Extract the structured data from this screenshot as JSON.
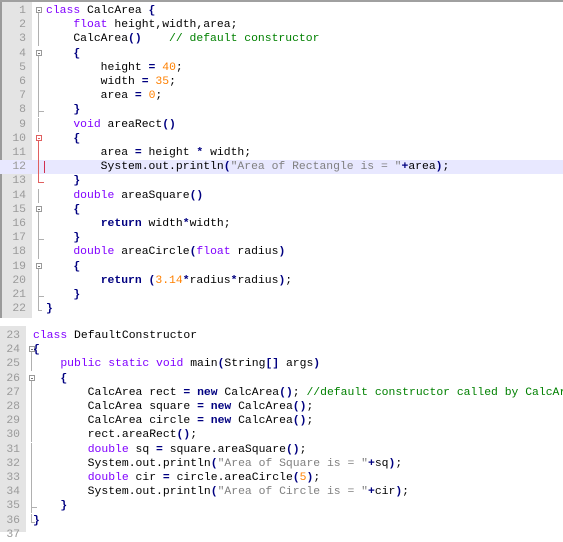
{
  "editor": {
    "panels": [
      {
        "id": "top",
        "lines": [
          {
            "n": "1",
            "tokens": [
              {
                "t": "class",
                "c": "kw"
              },
              {
                "t": " CalcArea ",
                "c": "txt"
              },
              {
                "t": "{",
                "c": "op"
              }
            ]
          },
          {
            "n": "2",
            "tokens": [
              {
                "t": "    ",
                "c": "txt"
              },
              {
                "t": "float",
                "c": "kw"
              },
              {
                "t": " height,width,area;",
                "c": "txt"
              }
            ]
          },
          {
            "n": "3",
            "tokens": [
              {
                "t": "    CalcArea",
                "c": "txt"
              },
              {
                "t": "()",
                "c": "op"
              },
              {
                "t": "    ",
                "c": "txt"
              },
              {
                "t": "// default constructor",
                "c": "cmt"
              }
            ]
          },
          {
            "n": "4",
            "tokens": [
              {
                "t": "    ",
                "c": "txt"
              },
              {
                "t": "{",
                "c": "op"
              }
            ]
          },
          {
            "n": "5",
            "tokens": [
              {
                "t": "        height ",
                "c": "txt"
              },
              {
                "t": "=",
                "c": "op"
              },
              {
                "t": " ",
                "c": "txt"
              },
              {
                "t": "40",
                "c": "num"
              },
              {
                "t": ";",
                "c": "txt"
              }
            ]
          },
          {
            "n": "6",
            "tokens": [
              {
                "t": "        width ",
                "c": "txt"
              },
              {
                "t": "=",
                "c": "op"
              },
              {
                "t": " ",
                "c": "txt"
              },
              {
                "t": "35",
                "c": "num"
              },
              {
                "t": ";",
                "c": "txt"
              }
            ]
          },
          {
            "n": "7",
            "tokens": [
              {
                "t": "        area ",
                "c": "txt"
              },
              {
                "t": "=",
                "c": "op"
              },
              {
                "t": " ",
                "c": "txt"
              },
              {
                "t": "0",
                "c": "num"
              },
              {
                "t": ";",
                "c": "txt"
              }
            ]
          },
          {
            "n": "8",
            "tokens": [
              {
                "t": "    ",
                "c": "txt"
              },
              {
                "t": "}",
                "c": "op"
              }
            ]
          },
          {
            "n": "9",
            "tokens": [
              {
                "t": "    ",
                "c": "txt"
              },
              {
                "t": "void",
                "c": "kw"
              },
              {
                "t": " areaRect",
                "c": "txt"
              },
              {
                "t": "()",
                "c": "op"
              }
            ]
          },
          {
            "n": "10",
            "tokens": [
              {
                "t": "    ",
                "c": "txt"
              },
              {
                "t": "{",
                "c": "op"
              }
            ]
          },
          {
            "n": "11",
            "tokens": [
              {
                "t": "        area ",
                "c": "txt"
              },
              {
                "t": "=",
                "c": "op"
              },
              {
                "t": " height ",
                "c": "txt"
              },
              {
                "t": "*",
                "c": "op"
              },
              {
                "t": " width;",
                "c": "txt"
              }
            ]
          },
          {
            "n": "12",
            "tokens": [
              {
                "t": "        System.out.println",
                "c": "txt"
              },
              {
                "t": "(",
                "c": "op"
              },
              {
                "t": "\"Area of Rectangle is = \"",
                "c": "str"
              },
              {
                "t": "+",
                "c": "op"
              },
              {
                "t": "area",
                "c": "txt"
              },
              {
                "t": ")",
                "c": "op"
              },
              {
                "t": ";",
                "c": "txt"
              }
            ]
          },
          {
            "n": "13",
            "tokens": [
              {
                "t": "    ",
                "c": "txt"
              },
              {
                "t": "}",
                "c": "op"
              }
            ]
          },
          {
            "n": "14",
            "tokens": [
              {
                "t": "    ",
                "c": "txt"
              },
              {
                "t": "double",
                "c": "kw"
              },
              {
                "t": " areaSquare",
                "c": "txt"
              },
              {
                "t": "()",
                "c": "op"
              }
            ]
          },
          {
            "n": "15",
            "tokens": [
              {
                "t": "    ",
                "c": "txt"
              },
              {
                "t": "{",
                "c": "op"
              }
            ]
          },
          {
            "n": "16",
            "tokens": [
              {
                "t": "        ",
                "c": "txt"
              },
              {
                "t": "return",
                "c": "kw2"
              },
              {
                "t": " width",
                "c": "txt"
              },
              {
                "t": "*",
                "c": "op"
              },
              {
                "t": "width;",
                "c": "txt"
              }
            ]
          },
          {
            "n": "17",
            "tokens": [
              {
                "t": "    ",
                "c": "txt"
              },
              {
                "t": "}",
                "c": "op"
              }
            ]
          },
          {
            "n": "18",
            "tokens": [
              {
                "t": "    ",
                "c": "txt"
              },
              {
                "t": "double",
                "c": "kw"
              },
              {
                "t": " areaCircle",
                "c": "txt"
              },
              {
                "t": "(",
                "c": "op"
              },
              {
                "t": "float",
                "c": "kw"
              },
              {
                "t": " radius",
                "c": "txt"
              },
              {
                "t": ")",
                "c": "op"
              }
            ]
          },
          {
            "n": "19",
            "tokens": [
              {
                "t": "    ",
                "c": "txt"
              },
              {
                "t": "{",
                "c": "op"
              }
            ]
          },
          {
            "n": "20",
            "tokens": [
              {
                "t": "        ",
                "c": "txt"
              },
              {
                "t": "return",
                "c": "kw2"
              },
              {
                "t": " ",
                "c": "txt"
              },
              {
                "t": "(",
                "c": "op"
              },
              {
                "t": "3.14",
                "c": "num"
              },
              {
                "t": "*",
                "c": "op"
              },
              {
                "t": "radius",
                "c": "txt"
              },
              {
                "t": "*",
                "c": "op"
              },
              {
                "t": "radius",
                "c": "txt"
              },
              {
                "t": ")",
                "c": "op"
              },
              {
                "t": ";",
                "c": "txt"
              }
            ]
          },
          {
            "n": "21",
            "tokens": [
              {
                "t": "    ",
                "c": "txt"
              },
              {
                "t": "}",
                "c": "op"
              }
            ]
          },
          {
            "n": "22",
            "tokens": [
              {
                "t": "}",
                "c": "op"
              }
            ]
          }
        ]
      },
      {
        "id": "bottom",
        "lines": [
          {
            "n": "23",
            "tokens": [
              {
                "t": "class",
                "c": "kw"
              },
              {
                "t": " DefaultConstructor",
                "c": "txt"
              }
            ]
          },
          {
            "n": "24",
            "tokens": [
              {
                "t": "{",
                "c": "op"
              }
            ]
          },
          {
            "n": "25",
            "tokens": [
              {
                "t": "    ",
                "c": "txt"
              },
              {
                "t": "public static void",
                "c": "kw"
              },
              {
                "t": " main",
                "c": "txt"
              },
              {
                "t": "(",
                "c": "op"
              },
              {
                "t": "String",
                "c": "txt"
              },
              {
                "t": "[]",
                "c": "op"
              },
              {
                "t": " args",
                "c": "txt"
              },
              {
                "t": ")",
                "c": "op"
              }
            ]
          },
          {
            "n": "26",
            "tokens": [
              {
                "t": "    ",
                "c": "txt"
              },
              {
                "t": "{",
                "c": "op"
              }
            ]
          },
          {
            "n": "27",
            "tokens": [
              {
                "t": "        CalcArea rect ",
                "c": "txt"
              },
              {
                "t": "=",
                "c": "op"
              },
              {
                "t": " ",
                "c": "txt"
              },
              {
                "t": "new",
                "c": "kw2"
              },
              {
                "t": " CalcArea",
                "c": "txt"
              },
              {
                "t": "()",
                "c": "op"
              },
              {
                "t": "; ",
                "c": "txt"
              },
              {
                "t": "//default constructor called by CalcArea();",
                "c": "cmt"
              }
            ]
          },
          {
            "n": "28",
            "tokens": [
              {
                "t": "        CalcArea square ",
                "c": "txt"
              },
              {
                "t": "=",
                "c": "op"
              },
              {
                "t": " ",
                "c": "txt"
              },
              {
                "t": "new",
                "c": "kw2"
              },
              {
                "t": " CalcArea",
                "c": "txt"
              },
              {
                "t": "()",
                "c": "op"
              },
              {
                "t": ";",
                "c": "txt"
              }
            ]
          },
          {
            "n": "29",
            "tokens": [
              {
                "t": "        CalcArea circle ",
                "c": "txt"
              },
              {
                "t": "=",
                "c": "op"
              },
              {
                "t": " ",
                "c": "txt"
              },
              {
                "t": "new",
                "c": "kw2"
              },
              {
                "t": " CalcArea",
                "c": "txt"
              },
              {
                "t": "()",
                "c": "op"
              },
              {
                "t": ";",
                "c": "txt"
              }
            ]
          },
          {
            "n": "30",
            "tokens": [
              {
                "t": "        rect.areaRect",
                "c": "txt"
              },
              {
                "t": "()",
                "c": "op"
              },
              {
                "t": ";",
                "c": "txt"
              }
            ]
          },
          {
            "n": "31",
            "tokens": [
              {
                "t": "        ",
                "c": "txt"
              },
              {
                "t": "double",
                "c": "kw"
              },
              {
                "t": " sq ",
                "c": "txt"
              },
              {
                "t": "=",
                "c": "op"
              },
              {
                "t": " square.areaSquare",
                "c": "txt"
              },
              {
                "t": "()",
                "c": "op"
              },
              {
                "t": ";",
                "c": "txt"
              }
            ]
          },
          {
            "n": "32",
            "tokens": [
              {
                "t": "        System.out.println",
                "c": "txt"
              },
              {
                "t": "(",
                "c": "op"
              },
              {
                "t": "\"Area of Square is = \"",
                "c": "str"
              },
              {
                "t": "+",
                "c": "op"
              },
              {
                "t": "sq",
                "c": "txt"
              },
              {
                "t": ")",
                "c": "op"
              },
              {
                "t": ";",
                "c": "txt"
              }
            ]
          },
          {
            "n": "33",
            "tokens": [
              {
                "t": "        ",
                "c": "txt"
              },
              {
                "t": "double",
                "c": "kw"
              },
              {
                "t": " cir ",
                "c": "txt"
              },
              {
                "t": "=",
                "c": "op"
              },
              {
                "t": " circle.areaCircle",
                "c": "txt"
              },
              {
                "t": "(",
                "c": "op"
              },
              {
                "t": "5",
                "c": "num"
              },
              {
                "t": ")",
                "c": "op"
              },
              {
                "t": ";",
                "c": "txt"
              }
            ]
          },
          {
            "n": "34",
            "tokens": [
              {
                "t": "        System.out.println",
                "c": "txt"
              },
              {
                "t": "(",
                "c": "op"
              },
              {
                "t": "\"Area of Circle is = \"",
                "c": "str"
              },
              {
                "t": "+",
                "c": "op"
              },
              {
                "t": "cir",
                "c": "txt"
              },
              {
                "t": ")",
                "c": "op"
              },
              {
                "t": ";",
                "c": "txt"
              }
            ]
          },
          {
            "n": "35",
            "tokens": [
              {
                "t": "    ",
                "c": "txt"
              },
              {
                "t": "}",
                "c": "op"
              }
            ]
          },
          {
            "n": "36",
            "tokens": [
              {
                "t": "}",
                "c": "op"
              }
            ]
          },
          {
            "n": "37",
            "tokens": []
          }
        ]
      }
    ],
    "current_line": "12",
    "colors": {
      "keyword": "#8000ff",
      "instruction_keyword": "#000080",
      "number": "#ff8000",
      "string": "#808080",
      "comment": "#008000",
      "current_line_bg": "#e8e8ff",
      "gutter_bg": "#e4e4e4"
    }
  }
}
